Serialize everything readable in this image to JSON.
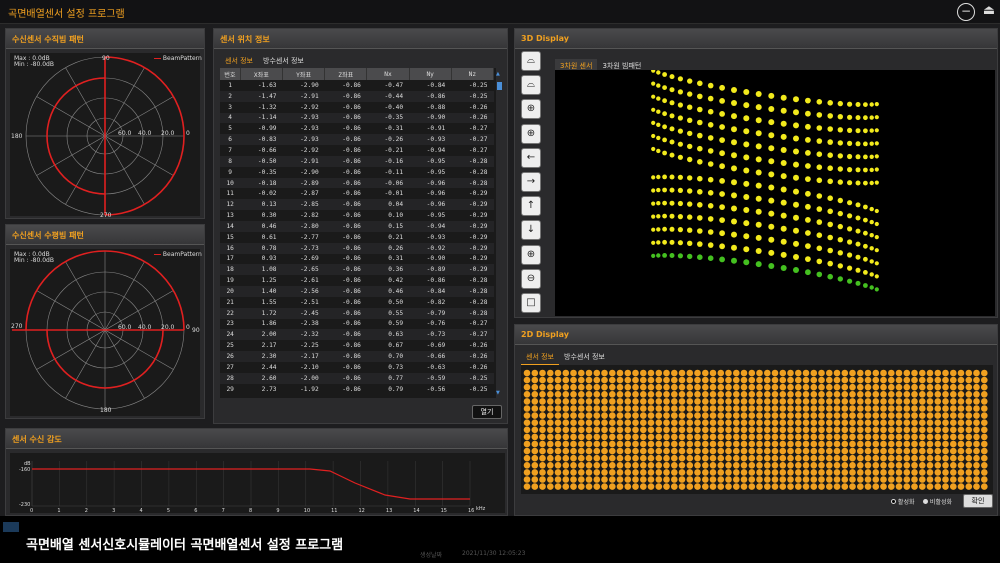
{
  "app": {
    "title": "곡면배열센서 설정 프로그램"
  },
  "beam_v": {
    "title": "수신센서 수직빔 패턴",
    "max": "Max : 0.0dB",
    "min": "Min : -80.0dB",
    "legend": "BeamPattern",
    "a_top": "90",
    "a_left": "180",
    "a_bottom": "270",
    "r1": "60.0",
    "r2": "40.0",
    "r3": "20.0",
    "r0": "0"
  },
  "beam_h": {
    "title": "수신센서 수평빔 패턴",
    "max": "Max : 0.0dB",
    "min": "Min : -80.0dB",
    "legend": "BeamPattern",
    "a_right": "90",
    "a_left": "270",
    "a_bottom": "180",
    "r1": "60.0",
    "r2": "40.0",
    "r3": "20.0",
    "r0": "0"
  },
  "pos": {
    "title": "센서 위치 정보",
    "tabs": [
      "센서 정보",
      "방수센서 정보"
    ],
    "cols": [
      "번호",
      "X좌표",
      "Y좌표",
      "Z좌표",
      "Nx",
      "Ny",
      "Nz"
    ],
    "rows": [
      [
        "1",
        "-1.63",
        "-2.90",
        "-0.86",
        "-0.47",
        "-0.84",
        "-0.25"
      ],
      [
        "2",
        "-1.47",
        "-2.91",
        "-0.86",
        "-0.44",
        "-0.86",
        "-0.25"
      ],
      [
        "3",
        "-1.32",
        "-2.92",
        "-0.86",
        "-0.40",
        "-0.88",
        "-0.26"
      ],
      [
        "4",
        "-1.14",
        "-2.93",
        "-0.86",
        "-0.35",
        "-0.90",
        "-0.26"
      ],
      [
        "5",
        "-0.99",
        "-2.93",
        "-0.86",
        "-0.31",
        "-0.91",
        "-0.27"
      ],
      [
        "6",
        "-0.83",
        "-2.93",
        "-0.86",
        "-0.26",
        "-0.93",
        "-0.27"
      ],
      [
        "7",
        "-0.66",
        "-2.92",
        "-0.86",
        "-0.21",
        "-0.94",
        "-0.27"
      ],
      [
        "8",
        "-0.50",
        "-2.91",
        "-0.86",
        "-0.16",
        "-0.95",
        "-0.28"
      ],
      [
        "9",
        "-0.35",
        "-2.90",
        "-0.86",
        "-0.11",
        "-0.95",
        "-0.28"
      ],
      [
        "10",
        "-0.18",
        "-2.89",
        "-0.86",
        "-0.06",
        "-0.96",
        "-0.28"
      ],
      [
        "11",
        "-0.02",
        "-2.87",
        "-0.86",
        "-0.01",
        "-0.96",
        "-0.29"
      ],
      [
        "12",
        "0.13",
        "-2.85",
        "-0.86",
        "0.04",
        "-0.96",
        "-0.29"
      ],
      [
        "13",
        "0.30",
        "-2.82",
        "-0.86",
        "0.10",
        "-0.95",
        "-0.29"
      ],
      [
        "14",
        "0.46",
        "-2.80",
        "-0.86",
        "0.15",
        "-0.94",
        "-0.29"
      ],
      [
        "15",
        "0.61",
        "-2.77",
        "-0.86",
        "0.21",
        "-0.93",
        "-0.29"
      ],
      [
        "16",
        "0.78",
        "-2.73",
        "-0.86",
        "0.26",
        "-0.92",
        "-0.29"
      ],
      [
        "17",
        "0.93",
        "-2.69",
        "-0.86",
        "0.31",
        "-0.90",
        "-0.29"
      ],
      [
        "18",
        "1.08",
        "-2.65",
        "-0.86",
        "0.36",
        "-0.89",
        "-0.29"
      ],
      [
        "19",
        "1.25",
        "-2.61",
        "-0.86",
        "0.42",
        "-0.86",
        "-0.28"
      ],
      [
        "20",
        "1.40",
        "-2.56",
        "-0.86",
        "0.46",
        "-0.84",
        "-0.28"
      ],
      [
        "21",
        "1.55",
        "-2.51",
        "-0.86",
        "0.50",
        "-0.82",
        "-0.28"
      ],
      [
        "22",
        "1.72",
        "-2.45",
        "-0.86",
        "0.55",
        "-0.79",
        "-0.28"
      ],
      [
        "23",
        "1.86",
        "-2.38",
        "-0.86",
        "0.59",
        "-0.76",
        "-0.27"
      ],
      [
        "24",
        "2.00",
        "-2.32",
        "-0.86",
        "0.63",
        "-0.73",
        "-0.27"
      ],
      [
        "25",
        "2.17",
        "-2.25",
        "-0.86",
        "0.67",
        "-0.69",
        "-0.26"
      ],
      [
        "26",
        "2.30",
        "-2.17",
        "-0.86",
        "0.70",
        "-0.66",
        "-0.26"
      ],
      [
        "27",
        "2.44",
        "-2.10",
        "-0.86",
        "0.73",
        "-0.63",
        "-0.26"
      ],
      [
        "28",
        "2.60",
        "-2.00",
        "-0.86",
        "0.77",
        "-0.59",
        "-0.25"
      ],
      [
        "29",
        "2.73",
        "-1.92",
        "-0.86",
        "0.79",
        "-0.56",
        "-0.25"
      ]
    ],
    "open": "열기"
  },
  "d3": {
    "title": "3D Display",
    "tabs": [
      "3차원 센서",
      "3차원 빔패턴"
    ],
    "tools": [
      "rotate-up-icon",
      "rotate-down-icon",
      "rotate-left-icon",
      "rotate-right-icon",
      "pan-left-icon",
      "pan-right-icon",
      "pan-up-icon",
      "pan-down-icon",
      "zoom-in-icon",
      "zoom-out-icon",
      "reset-view-icon"
    ],
    "sensor_color": "#f2ea1c",
    "edge_color": "#44c020"
  },
  "d2": {
    "title": "2D Display",
    "tabs": [
      "센서 정보",
      "방수센서 정보"
    ],
    "active": "활성화",
    "inactive": "비활성화",
    "confirm": "확인",
    "dot_color": "#f0a020"
  },
  "resp": {
    "title": "센서 수신 감도",
    "ylabel": "dB",
    "xunit": "kHz",
    "yticks": [
      "-160",
      "-230"
    ],
    "xticks": [
      "0",
      "1",
      "2",
      "3",
      "4",
      "5",
      "6",
      "7",
      "8",
      "9",
      "10",
      "11",
      "12",
      "13",
      "14",
      "15",
      "16"
    ]
  },
  "status": {
    "l1": "생성날짜",
    "l2": "2021/11/30 12:05:23"
  },
  "caption": "곡면배열 센서신호시뮬레이터 곡면배열센서 설정 프로그램"
}
